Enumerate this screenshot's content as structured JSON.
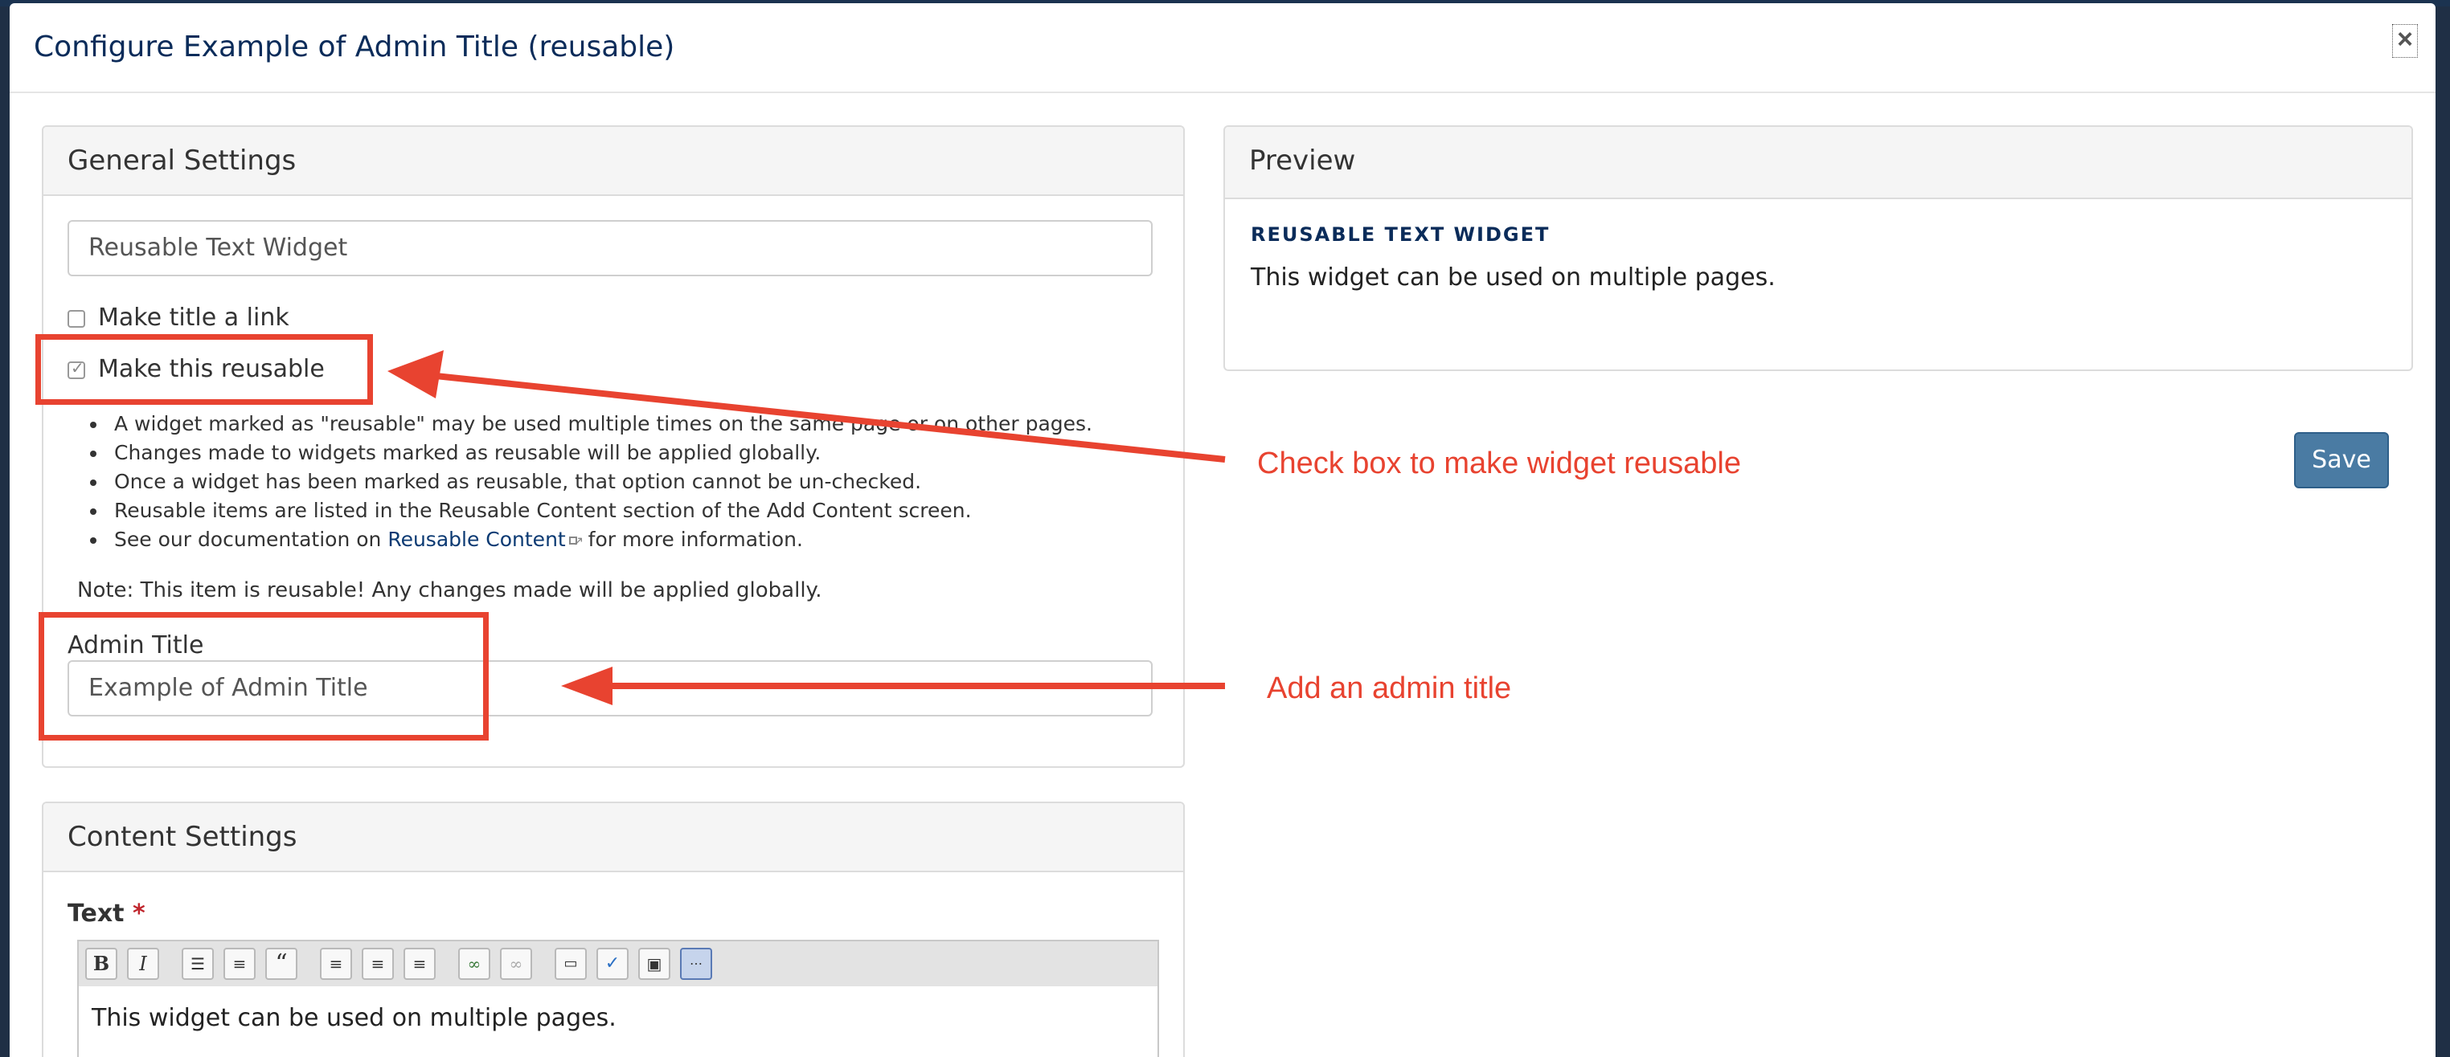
{
  "modal": {
    "title": "Configure Example of Admin Title (reusable)",
    "close_label": "×"
  },
  "general_settings": {
    "heading": "General Settings",
    "title_value": "Reusable Text Widget",
    "make_title_link_label": "Make title a link",
    "make_title_link_checked": false,
    "make_reusable_label": "Make this reusable",
    "make_reusable_checked": true,
    "bullets": [
      "A widget marked as \"reusable\" may be used multiple times on the same page or on other pages.",
      "Changes made to widgets marked as reusable will be applied globally.",
      "Once a widget has been marked as reusable, that option cannot be un-checked.",
      "Reusable items are listed in the Reusable Content section of the Add Content screen."
    ],
    "doc_bullet_prefix": "See our documentation on ",
    "doc_link_text": "Reusable Content",
    "doc_bullet_suffix": " for more information.",
    "note": "Note: This item is reusable! Any changes made will be applied globally.",
    "admin_title_label": "Admin Title",
    "admin_title_value": "Example of Admin Title"
  },
  "content_settings": {
    "heading": "Content Settings",
    "text_label": "Text",
    "required_marker": "*",
    "toolbar_icons": [
      "bold-icon",
      "italic-icon",
      "bulleted-list-icon",
      "numbered-list-icon",
      "blockquote-icon",
      "align-left-icon",
      "align-center-icon",
      "align-right-icon",
      "link-icon",
      "unlink-icon",
      "source-icon",
      "spellcheck-icon",
      "image-icon",
      "show-blocks-icon"
    ],
    "editor_text": "This widget can be used on multiple pages."
  },
  "preview": {
    "heading": "Preview",
    "widget_title": "REUSABLE TEXT WIDGET",
    "widget_body": "This widget can be used on multiple pages."
  },
  "actions": {
    "save_label": "Save"
  },
  "annotations": {
    "reusable_callout": "Check box to make widget reusable",
    "admin_title_callout": "Add an admin title",
    "color": "#e84330"
  }
}
